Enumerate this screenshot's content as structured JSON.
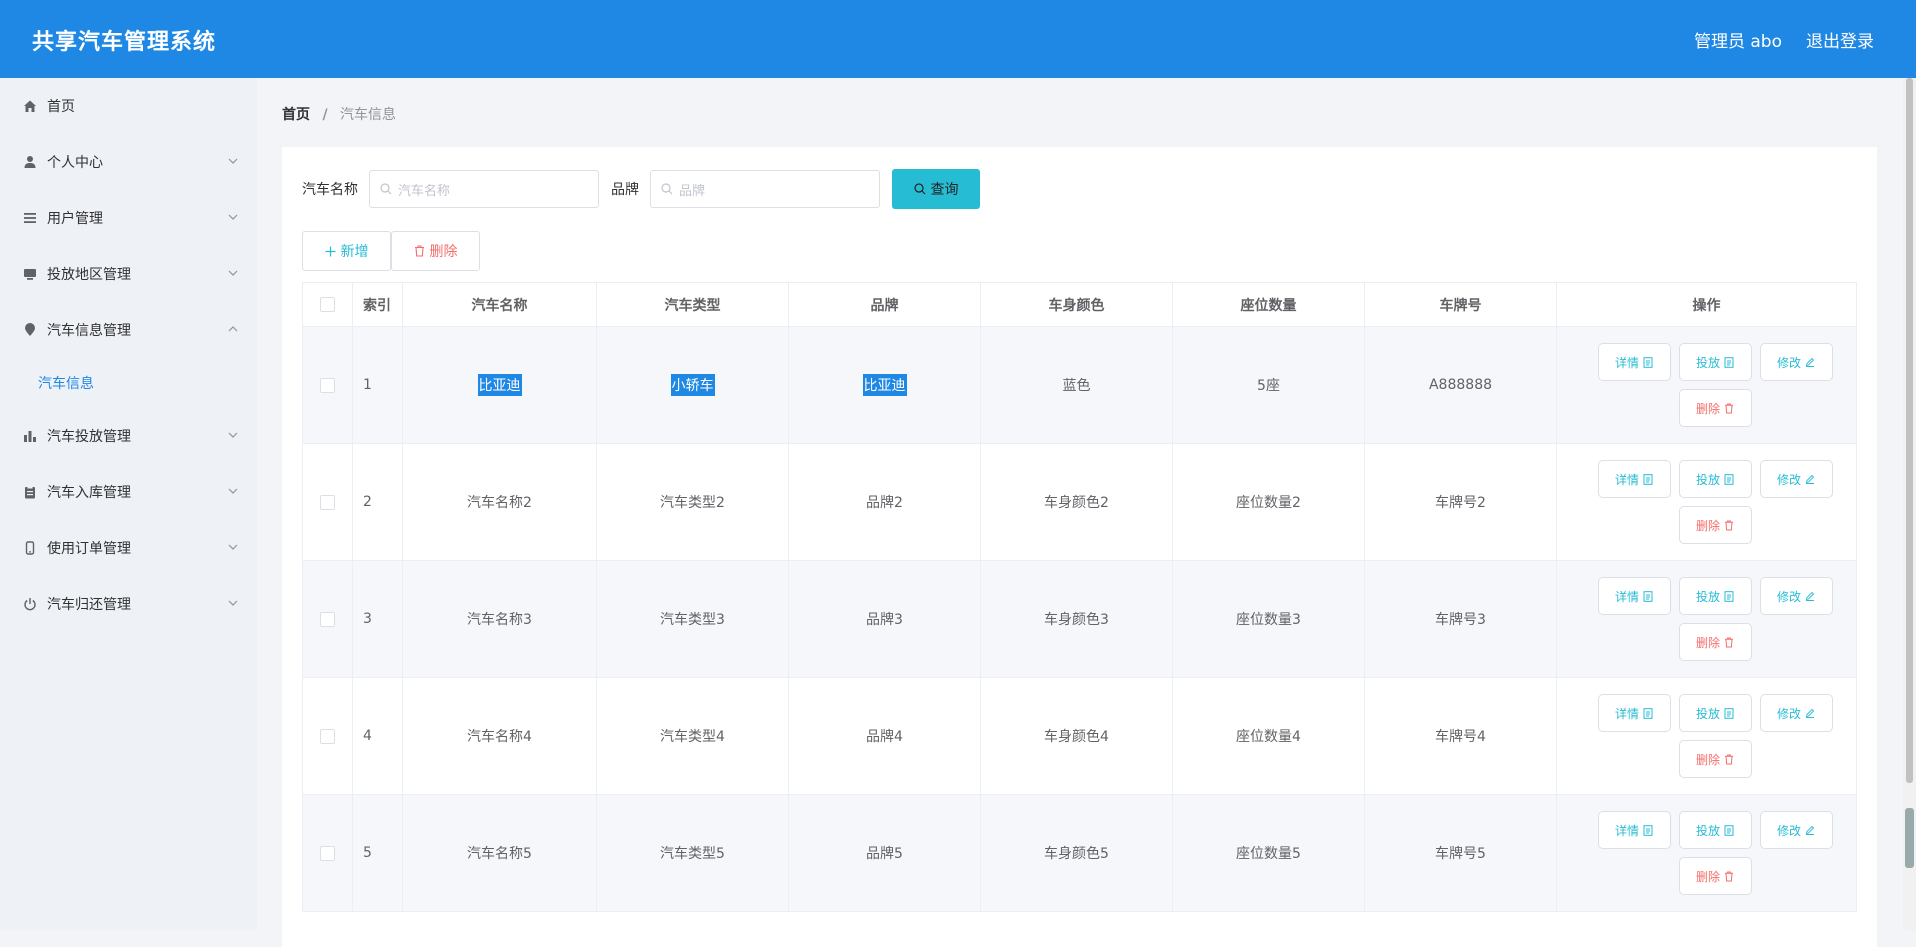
{
  "header": {
    "title": "共享汽车管理系统",
    "admin_label": "管理员 abo",
    "logout_label": "退出登录"
  },
  "sidebar": {
    "items": [
      {
        "label": "首页",
        "icon": "home-icon"
      },
      {
        "label": "个人中心",
        "icon": "user-icon"
      },
      {
        "label": "用户管理",
        "icon": "list-icon"
      },
      {
        "label": "投放地区管理",
        "icon": "monitor-icon"
      },
      {
        "label": "汽车信息管理",
        "icon": "location-icon"
      },
      {
        "label": "汽车信息",
        "icon": ""
      },
      {
        "label": "汽车投放管理",
        "icon": "chart-icon"
      },
      {
        "label": "汽车入库管理",
        "icon": "clipboard-icon"
      },
      {
        "label": "使用订单管理",
        "icon": "phone-icon"
      },
      {
        "label": "汽车归还管理",
        "icon": "power-icon"
      }
    ]
  },
  "breadcrumb": {
    "home": "首页",
    "separator": "/",
    "current": "汽车信息"
  },
  "search": {
    "name_label": "汽车名称",
    "name_placeholder": "汽车名称",
    "brand_label": "品牌",
    "brand_placeholder": "品牌",
    "query_label": "查询"
  },
  "actions": {
    "add_label": "新增",
    "delete_label": "删除"
  },
  "table": {
    "headers": {
      "index": "索引",
      "name": "汽车名称",
      "type": "汽车类型",
      "brand": "品牌",
      "color": "车身颜色",
      "seats": "座位数量",
      "plate": "车牌号",
      "ops": "操作"
    },
    "op_labels": {
      "detail": "详情",
      "deploy": "投放",
      "edit": "修改",
      "delete": "删除"
    },
    "rows": [
      {
        "index": "1",
        "name": "比亚迪",
        "type": "小轿车",
        "brand": "比亚迪",
        "color": "蓝色",
        "seats": "5座",
        "plate": "A888888"
      },
      {
        "index": "2",
        "name": "汽车名称2",
        "type": "汽车类型2",
        "brand": "品牌2",
        "color": "车身颜色2",
        "seats": "座位数量2",
        "plate": "车牌号2"
      },
      {
        "index": "3",
        "name": "汽车名称3",
        "type": "汽车类型3",
        "brand": "品牌3",
        "color": "车身颜色3",
        "seats": "座位数量3",
        "plate": "车牌号3"
      },
      {
        "index": "4",
        "name": "汽车名称4",
        "type": "汽车类型4",
        "brand": "品牌4",
        "color": "车身颜色4",
        "seats": "座位数量4",
        "plate": "车牌号4"
      },
      {
        "index": "5",
        "name": "汽车名称5",
        "type": "汽车类型5",
        "brand": "品牌5",
        "color": "车身颜色5",
        "seats": "座位数量5",
        "plate": "车牌号5"
      }
    ]
  },
  "colors": {
    "header_bg": "#1f88e5",
    "accent": "#26bcd4",
    "danger": "#f56c6c"
  }
}
